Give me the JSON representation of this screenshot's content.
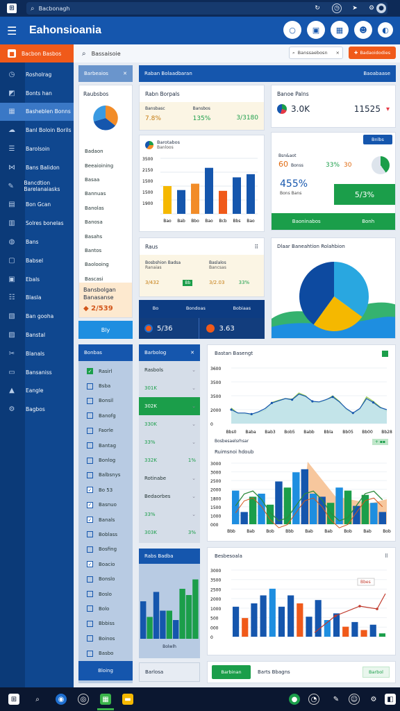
{
  "browser": {
    "url_text": "Bacbonagh"
  },
  "header": {
    "brand": "Eahonsioania"
  },
  "sidebar": {
    "top_label": "Bacbon Basbos",
    "items": [
      {
        "label": "Rosholrag",
        "icon": "dashboard-icon"
      },
      {
        "label": "Bonts han",
        "icon": "chart-icon"
      },
      {
        "label": "Basheblen Bonns",
        "icon": "grid-icon"
      },
      {
        "label": "Banl Boloin Borils",
        "icon": "cloud-icon"
      },
      {
        "label": "Barolsoin",
        "icon": "list-icon"
      },
      {
        "label": "Bans Balidon",
        "icon": "network-icon"
      },
      {
        "label": "Bancdtion Barelanaiasks",
        "icon": "pen-icon"
      },
      {
        "label": "Bon Gcan",
        "icon": "table-icon"
      },
      {
        "label": "Solres bonelas",
        "icon": "bars-icon"
      },
      {
        "label": "Bans",
        "icon": "globe-icon"
      },
      {
        "label": "Babsel",
        "icon": "box-icon"
      },
      {
        "label": "Ebals",
        "icon": "file-icon"
      },
      {
        "label": "Blasla",
        "icon": "users-icon"
      },
      {
        "label": "Ban gooha",
        "icon": "calendar-icon"
      },
      {
        "label": "Banstal",
        "icon": "database-icon"
      },
      {
        "label": "Blanals",
        "icon": "tools-icon"
      },
      {
        "label": "Bansaniss",
        "icon": "window-icon"
      },
      {
        "label": "Eangle",
        "icon": "alert-icon"
      },
      {
        "label": "Bagbos",
        "icon": "gear-icon"
      }
    ]
  },
  "search": {
    "label": "Bassaisoie",
    "box_placeholder": "Banssaebosn",
    "button": "Badaoidodies"
  },
  "col1": {
    "header": "Barbeaios",
    "card_title": "Raubsbos",
    "items": [
      "Badaon",
      "Beeaioining",
      "Basaa",
      "Bannuas",
      "Banolas",
      "Banosa",
      "Basahs",
      "Bantos",
      "Baolooing",
      "Bascasi"
    ],
    "highlight_title": "Bansbolgan",
    "highlight_sub": "Banasanse",
    "highlight_value": "2/539",
    "button": "Bly"
  },
  "col2": {
    "banner": "Raban Bolaadbaran",
    "banner_action": "Baoabaase",
    "card1_title": "Rabn Borpals",
    "card1_stats": [
      {
        "label": "Bansbasc",
        "value": "7.8%"
      },
      {
        "label": "Bansbos",
        "value": "135%"
      },
      {
        "label": "",
        "value": "3/3180"
      }
    ],
    "chart1_title": "Barotabos",
    "chart1_sub": "Banloos",
    "chart1": {
      "type": "bar",
      "categories": [
        "Bao",
        "Bab",
        "Bbo",
        "Bao",
        "Bcb",
        "Bbs",
        "Bao"
      ],
      "values": [
        1750,
        1500,
        1900,
        2900,
        1450,
        2300,
        2500
      ],
      "ylim": [
        0,
        3500
      ],
      "ticks": [
        "3500",
        "2150",
        "1500",
        "1500",
        "1900",
        ""
      ],
      "xlabels": [
        "Bao",
        "Bab",
        "Bbo",
        "Bao",
        "Bcb",
        "Bbs",
        "Bao"
      ]
    },
    "card2_title": "Raus",
    "card2_rows": [
      {
        "label": "Bosbshion Badsa",
        "sub": "Ranaias",
        "value1": "3/432",
        "tag1": "Bb"
      },
      {
        "label": "Baslalos",
        "sub": "Bancsas",
        "value1": "3/2.03",
        "value2": "33%"
      }
    ],
    "dark_bar": {
      "a": "Bo",
      "b": "Bondoas",
      "c": "Bobiaas",
      "v1": "5/36",
      "v2": "3.63"
    }
  },
  "col3": {
    "card_title": "Banoe Palns",
    "big1": "3.0K",
    "big2": "11525",
    "button": "Bnlbs",
    "mid_label": "Bsn&aot",
    "mid_values": [
      "60",
      "33%",
      "30"
    ],
    "mid_subs": [
      "Bonss",
      "Eaoos"
    ],
    "big_pct": "455%",
    "big_pct_sub": "Bons Bans",
    "green_box": "5/3%",
    "green_bar_left": "Baoninabos",
    "green_bar_right": "Bonh",
    "pie_title": "Dlaar Baneahtion Rolahbion",
    "pie": {
      "type": "pie",
      "values": [
        35,
        25,
        40
      ]
    }
  },
  "lower_left": {
    "header": "Bonbas",
    "rows": [
      {
        "label": "Rasirl",
        "checked": "green"
      },
      {
        "label": "Bsba",
        "checked": "none"
      },
      {
        "label": "Bonsil",
        "checked": "none"
      },
      {
        "label": "Banofg",
        "checked": "none"
      },
      {
        "label": "Faorle",
        "checked": "none"
      },
      {
        "label": "Bantag",
        "checked": "none"
      },
      {
        "label": "Bonlog",
        "checked": "none"
      },
      {
        "label": "Balbsnys",
        "checked": "none"
      },
      {
        "label": "Bo 53",
        "checked": "blue"
      },
      {
        "label": "Basnuo",
        "checked": "blue"
      },
      {
        "label": "Banals",
        "checked": "blue"
      },
      {
        "label": "Boblass",
        "checked": "none"
      },
      {
        "label": "Bosfing",
        "checked": "none"
      },
      {
        "label": "Boacio",
        "checked": "blue"
      },
      {
        "label": "Bonslo",
        "checked": "none"
      },
      {
        "label": "Boslo",
        "checked": "none"
      },
      {
        "label": "Bolo",
        "checked": "none"
      },
      {
        "label": "Bbbiss",
        "checked": "none"
      },
      {
        "label": "Boinos",
        "checked": "none"
      },
      {
        "label": "Basbo",
        "checked": "none"
      }
    ],
    "button": "Bloing"
  },
  "lower_mid": {
    "header": "Barbolog",
    "rows": [
      {
        "label": "Rasbols",
        "value": ""
      },
      {
        "label": "301K",
        "value": ""
      },
      {
        "label": "302K",
        "value": "",
        "highlight": "true"
      },
      {
        "label": "330K",
        "value": ""
      },
      {
        "label": "33%",
        "value": ""
      },
      {
        "label": "332K",
        "value": "1%"
      },
      {
        "label": "Rotinabe",
        "value": ""
      },
      {
        "label": "Bedaorbes",
        "value": ""
      },
      {
        "label": "33%",
        "value": ""
      },
      {
        "label": "303K",
        "value": "3%"
      }
    ],
    "chart_title": "Rabs Badba",
    "chart_foot": "Bolwlh",
    "footer": "Barlosa",
    "chart2": {
      "type": "bar",
      "values": [
        0.6,
        0.35,
        0.75,
        0.45,
        0.45,
        0.3,
        0.8,
        0.7,
        0.95
      ]
    }
  },
  "lower_right": {
    "chart_a": {
      "title": "Bastan Basengt",
      "type": "area",
      "ylabels": [
        "3600",
        "3500",
        "3500",
        "2000",
        "0"
      ],
      "xlabels": [
        "Bbs0",
        "Baba",
        "Bab3",
        "Bob5",
        "Babb",
        "Bbla",
        "Bb05",
        "Bb00",
        "Bb28"
      ],
      "series": [
        {
          "values": [
            0.72,
            0.82,
            0.82,
            0.85,
            0.8,
            0.76,
            0.62,
            0.58,
            0.55,
            0.56,
            0.45,
            0.5,
            0.62,
            0.62,
            0.58,
            0.5,
            0.6,
            0.75,
            0.82,
            0.74,
            0.52,
            0.6,
            0.7,
            0.78
          ]
        },
        {
          "values": [
            0.7,
            0.76,
            0.76,
            0.78,
            0.74,
            0.68,
            0.58,
            0.54,
            0.5,
            0.52,
            0.42,
            0.46,
            0.55,
            0.56,
            0.52,
            0.47,
            0.56,
            0.68,
            0.76,
            0.68,
            0.5,
            0.57,
            0.66,
            0.7
          ]
        }
      ],
      "foot": "Bosbesaelsrhsar"
    },
    "chart_b": {
      "title": "Ruimsnoi hdoub",
      "type": "bar",
      "ylabels": [
        "3000",
        "3000",
        "2500",
        "2000",
        "1800",
        "1500",
        "1000",
        "000"
      ],
      "xlabels": [
        "Bbb",
        "Bab",
        "Bob",
        "Bbb",
        "Bab",
        "Bab",
        "Bob",
        "Bab",
        "Bob"
      ],
      "values": [
        0.55,
        0.2,
        0.45,
        0.5,
        0.32,
        0.7,
        0.6,
        0.85,
        0.9,
        0.5,
        0.45,
        0.35,
        0.6,
        0.55,
        0.3,
        0.48,
        0.35,
        0.2
      ]
    },
    "chart_c": {
      "title": "Besbesoala",
      "type": "bar",
      "ylabels": [
        "3000",
        "3500",
        "2500",
        "2000",
        "1000",
        "500",
        "000",
        "0"
      ],
      "values": [
        0.45,
        0.28,
        0.5,
        0.62,
        0.72,
        0.45,
        0.62,
        0.5,
        0.3,
        0.55,
        0.25,
        0.35,
        0.15,
        0.22,
        0.1,
        0.18,
        0.05
      ],
      "badge": "Bbes"
    },
    "footer_button": "Barbinan",
    "footer_text": "Barts Bbagns",
    "footer_right": "Barbol"
  },
  "colors": {
    "accent": "#1556ad",
    "orange": "#f05a1a",
    "green": "#1b9e4a",
    "teal": "#1e8ee0",
    "gold": "#f5b800"
  }
}
